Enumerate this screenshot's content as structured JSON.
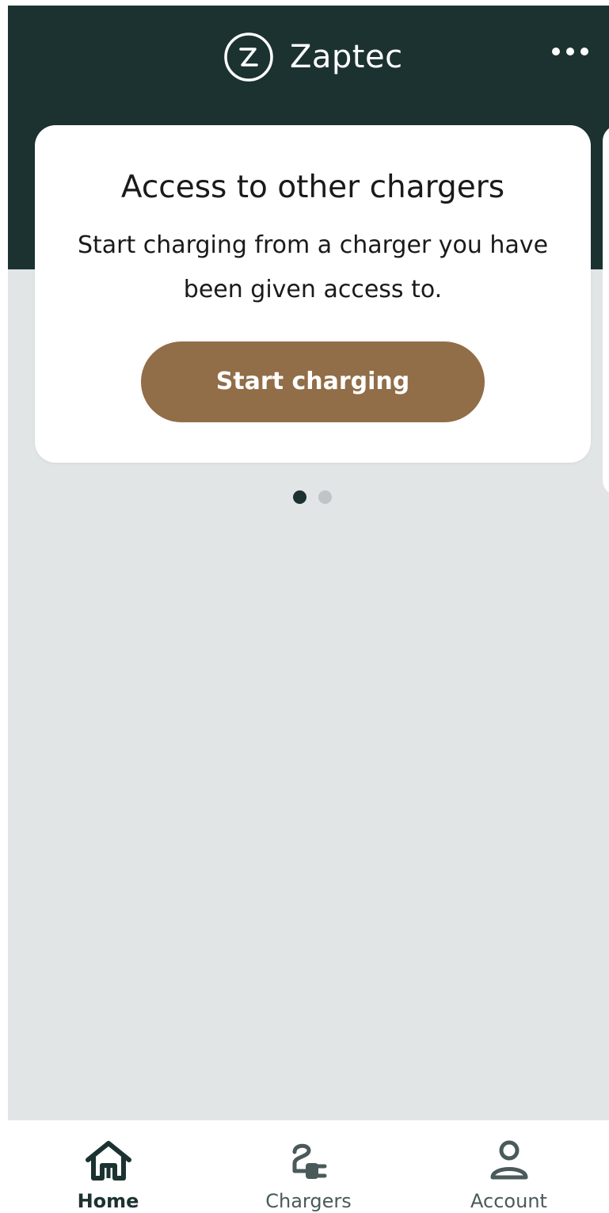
{
  "header": {
    "brand_name": "Zaptec",
    "logo_icon": "zaptec-logo-icon",
    "more_icon": "more-horizontal-icon"
  },
  "card": {
    "title": "Access to other chargers",
    "text": "Start charging from a charger you have been given access to.",
    "button_label": "Start charging"
  },
  "pager": {
    "page_count": 2,
    "active_index": 0
  },
  "bottom_nav": {
    "items": [
      {
        "label": "Home",
        "icon": "home-icon",
        "selected": true
      },
      {
        "label": "Chargers",
        "icon": "charger-plug-icon",
        "selected": false
      },
      {
        "label": "Account",
        "icon": "account-person-icon",
        "selected": false
      }
    ]
  },
  "colors": {
    "header_bg": "#1b3231",
    "screen_bg": "#e1e5e6",
    "button_bg": "#916d48",
    "pager_active": "#1b3231",
    "pager_inactive": "#bfc4c6"
  }
}
